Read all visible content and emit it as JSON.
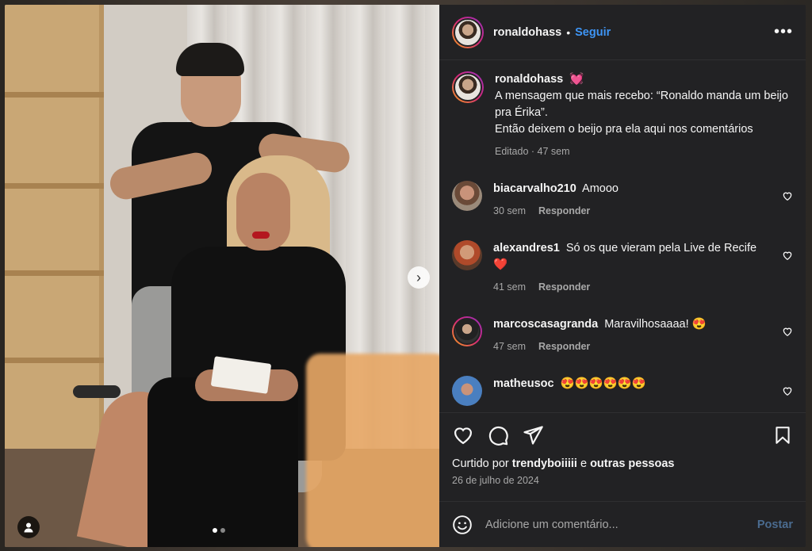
{
  "post": {
    "username": "ronaldohass",
    "follow_label": "Seguir",
    "separator": "•",
    "more_label": "•••",
    "next_label": "›"
  },
  "caption": {
    "username": "ronaldohass",
    "emoji": "💓",
    "line1": "A mensagem que mais recebo: “Ronaldo manda um beijo pra Érika”.",
    "line2": "Então deixem o beijo pra ela aqui nos comentários",
    "meta": "Editado · 47 sem"
  },
  "comments": [
    {
      "username": "biacarvalho210",
      "text": "Amooo",
      "time": "30 sem",
      "reply": "Responder",
      "avatar_color": "#8a6a55"
    },
    {
      "username": "alexandres1",
      "text": "Só os que vieram pela Live de Recife ❤️",
      "time": "41 sem",
      "reply": "Responder",
      "avatar_color": "#a45a3a"
    },
    {
      "username": "marcoscasagranda",
      "text": "Maravilhosaaaa! 😍",
      "time": "47 sem",
      "reply": "Responder",
      "avatar_color": "#3b3b3b"
    },
    {
      "username": "matheusoc",
      "text": "😍😍😍😍😍😍",
      "time": "",
      "reply": "",
      "avatar_color": "#4a7fc0"
    }
  ],
  "likes": {
    "prefix": "Curtido por",
    "user": "trendyboiiiii",
    "joiner": "e",
    "others": "outras pessoas"
  },
  "date": "26 de julho de 2024",
  "composer": {
    "placeholder": "Adicione um comentário...",
    "post_label": "Postar"
  },
  "icons": {
    "like": "heart-icon",
    "comment": "comment-icon",
    "share": "share-icon",
    "save": "bookmark-icon",
    "emoji": "emoji-icon",
    "tag": "user-tag-icon"
  },
  "carousel": {
    "current": 1,
    "total": 2
  },
  "colors": {
    "accent": "#3e95f5",
    "panel_bg": "#222224",
    "muted": "#a8a8a8"
  }
}
